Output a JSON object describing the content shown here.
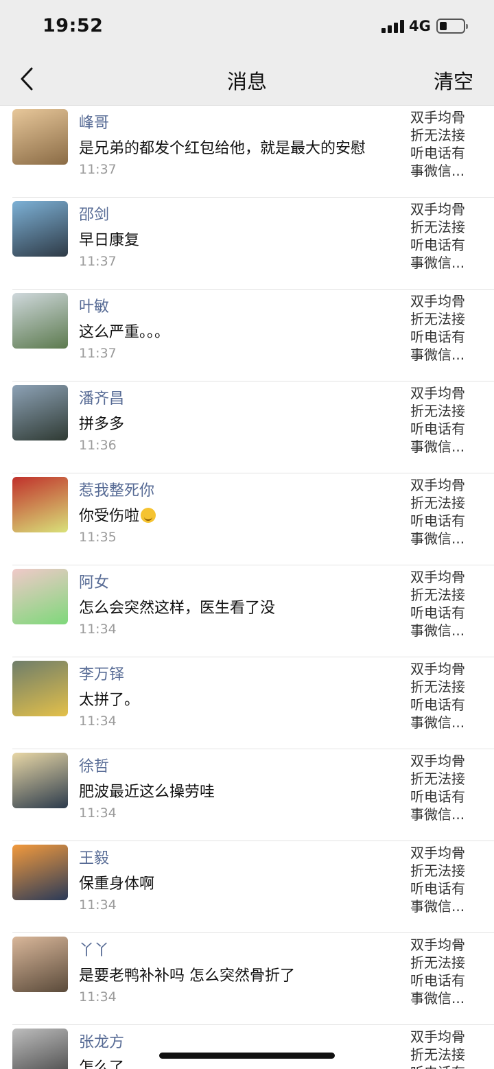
{
  "status_bar": {
    "time": "19:52",
    "network": "4G"
  },
  "nav": {
    "title": "消息",
    "right_action": "清空"
  },
  "original_post_preview": [
    "双手均骨",
    "折无法接",
    "听电话有",
    "事微信..."
  ],
  "messages": [
    {
      "name": "峰哥",
      "text": "是兄弟的都发个红包给他，就是最大的安慰",
      "time": "11:37",
      "avatar_colors": [
        "#e7c79a",
        "#8a6b45"
      ]
    },
    {
      "name": "邵剑",
      "text": "早日康复",
      "time": "11:37",
      "avatar_colors": [
        "#7db1d6",
        "#2e3a46"
      ]
    },
    {
      "name": "叶敏",
      "text": "这么严重。。。",
      "time": "11:37",
      "avatar_colors": [
        "#cfd8dc",
        "#5c7a4e"
      ]
    },
    {
      "name": "潘齐昌",
      "text": "拼多多",
      "time": "11:36",
      "avatar_colors": [
        "#8da2b6",
        "#2f3a33"
      ]
    },
    {
      "name": "惹我整死你",
      "text": "你受伤啦",
      "time": "11:35",
      "avatar_colors": [
        "#c0302b",
        "#d9e27a"
      ],
      "emoji": true
    },
    {
      "name": "阿女",
      "text": "怎么会突然这样，医生看了没",
      "time": "11:34",
      "avatar_colors": [
        "#f0c9c9",
        "#7ed87a"
      ]
    },
    {
      "name": "李万铎",
      "text": "太拼了。",
      "time": "11:34",
      "avatar_colors": [
        "#6e7d6a",
        "#e3c04a"
      ]
    },
    {
      "name": "徐哲",
      "text": "肥波最近这么操劳哇",
      "time": "11:34",
      "avatar_colors": [
        "#e8d7a6",
        "#2c3b4c"
      ]
    },
    {
      "name": "王毅",
      "text": "保重身体啊",
      "time": "11:34",
      "avatar_colors": [
        "#f29a3d",
        "#2a3a58"
      ]
    },
    {
      "name": "丫丫",
      "text": "是要老鸭补补吗 怎么突然骨折了",
      "time": "11:34",
      "avatar_colors": [
        "#d9b79a",
        "#5a4a3a"
      ]
    },
    {
      "name": "张龙方",
      "text": "怎么了",
      "time": "",
      "avatar_colors": [
        "#bdbdbd",
        "#3d3d3d"
      ]
    }
  ]
}
